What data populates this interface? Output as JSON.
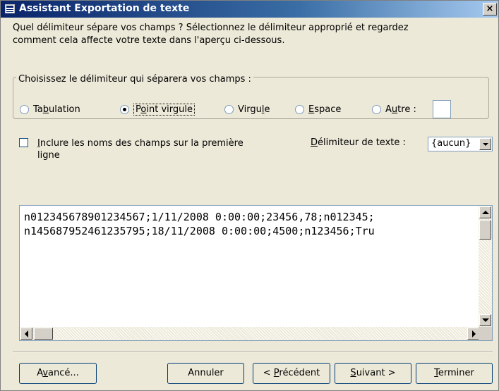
{
  "window": {
    "title": "Assistant Exportation de texte",
    "close_glyph": "×"
  },
  "description": {
    "line1": "Quel délimiteur sépare vos champs ?  Sélectionnez le délimiteur approprié et regardez",
    "line2": "comment cela affecte votre texte dans l'aperçu ci-dessous."
  },
  "delimiter_group": {
    "legend": "Choisissez le délimiteur qui séparera vos champs :",
    "options": [
      {
        "pre": "Ta",
        "acc": "b",
        "post": "ulation",
        "selected": false
      },
      {
        "pre": "P",
        "acc": "o",
        "post": "int virgule",
        "selected": true
      },
      {
        "pre": "Virgu",
        "acc": "l",
        "post": "e",
        "selected": false
      },
      {
        "pre": "",
        "acc": "E",
        "post": "space",
        "selected": false
      },
      {
        "pre": "A",
        "acc": "u",
        "post": "tre :",
        "selected": false
      }
    ],
    "autre_value": ""
  },
  "include_names": {
    "checked": false,
    "acc": "I",
    "rest": "nclure les noms des champs sur la première",
    "line2": "ligne"
  },
  "text_qualifier": {
    "acc": "D",
    "rest": "élimiteur de texte :",
    "value": "{aucun}"
  },
  "preview": {
    "lines": [
      "n012345678901234567;1/11/2008 0:00:00;23456,78;n012345;",
      "n145687952461235795;18/11/2008 0:00:00;4500;n123456;Tru"
    ]
  },
  "buttons": {
    "advanced": {
      "pre": "A",
      "acc": "v",
      "post": "ancé..."
    },
    "cancel": {
      "pre": "Annuler",
      "acc": "",
      "post": ""
    },
    "previous": {
      "pre": "< ",
      "acc": "P",
      "post": "récédent"
    },
    "next": {
      "pre": "",
      "acc": "S",
      "post": "uivant >"
    },
    "finish": {
      "pre": "",
      "acc": "T",
      "post": "erminer"
    }
  }
}
